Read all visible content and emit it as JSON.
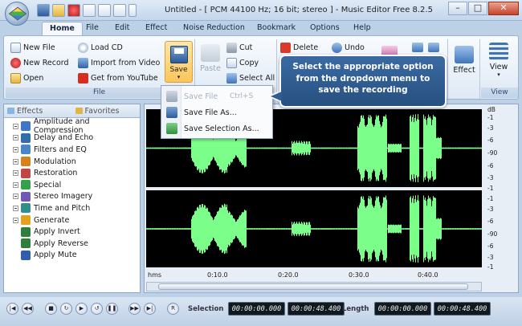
{
  "window": {
    "title": "Untitled - [ PCM 44100 Hz; 16 bit; stereo ] - Music Editor Free 8.2.5",
    "minimize": "–",
    "maximize": "□",
    "close": "✕"
  },
  "menu_tabs": [
    "Home",
    "File",
    "Edit",
    "Effect",
    "Noise Reduction",
    "Bookmark",
    "Options",
    "Help"
  ],
  "ribbon": {
    "file_group": {
      "label": "File",
      "new_file": "New File",
      "new_record": "New Record",
      "open": "Open",
      "load_cd": "Load CD",
      "import_video": "Import from Video",
      "get_youtube": "Get from YouTube",
      "save": "Save"
    },
    "edit_group": {
      "paste": "Paste",
      "cut": "Cut",
      "copy": "Copy",
      "select_all": "Select All",
      "delete": "Delete",
      "undo": "Undo"
    },
    "effect": "Effect",
    "view": "View",
    "view_group_label": "View"
  },
  "save_menu": [
    {
      "label": "Save File",
      "shortcut": "Ctrl+S",
      "disabled": true
    },
    {
      "label": "Save File As...",
      "shortcut": "",
      "disabled": false
    },
    {
      "label": "Save Selection As...",
      "shortcut": "",
      "disabled": false
    }
  ],
  "callout": "Select the appropriate option from the dropdown menu to save the recording",
  "left_panel": {
    "tab_effects": "Effects",
    "tab_favorites": "Favorites",
    "items": [
      {
        "label": "Amplitude and Compression",
        "icon": "amplitude-icon",
        "color": "#3d78c8"
      },
      {
        "label": "Delay and Echo",
        "icon": "echo-icon",
        "color": "#2f6fb0"
      },
      {
        "label": "Filters and EQ",
        "icon": "filter-icon",
        "color": "#4a86c8"
      },
      {
        "label": "Modulation",
        "icon": "modulation-icon",
        "color": "#d8801e"
      },
      {
        "label": "Restoration",
        "icon": "restoration-icon",
        "color": "#c34646"
      },
      {
        "label": "Special",
        "icon": "special-icon",
        "color": "#36a04a"
      },
      {
        "label": "Stereo Imagery",
        "icon": "stereo-icon",
        "color": "#6f58b6"
      },
      {
        "label": "Time and Pitch",
        "icon": "time-pitch-icon",
        "color": "#2f8f8a"
      },
      {
        "label": "Generate",
        "icon": "generate-icon",
        "color": "#e0a020"
      },
      {
        "label": "Apply Invert",
        "icon": "invert-icon",
        "color": "#2f7f3a"
      },
      {
        "label": "Apply Reverse",
        "icon": "reverse-icon",
        "color": "#2f7f3a"
      },
      {
        "label": "Apply Mute",
        "icon": "mute-icon",
        "color": "#2f5fa8"
      }
    ]
  },
  "db_labels": [
    "dB",
    "-1",
    "-3",
    "-6",
    "-90",
    "-6",
    "-3",
    "-1",
    "-1",
    "-3",
    "-6",
    "-90",
    "-6",
    "-3",
    "-1"
  ],
  "time_labels": [
    "hms",
    "0:10.0",
    "0:20.0",
    "0:30.0",
    "0:40.0"
  ],
  "status": {
    "selection_label": "Selection",
    "selection_start": "00:00:00.000",
    "selection_end": "00:00:48.400",
    "length_label": "Length",
    "length_start": "00:00:00.000",
    "length_end": "00:00:48.400"
  },
  "colors": {
    "waveform": "#7cff8a",
    "background": "#000000",
    "callout": "#2f5d92"
  }
}
